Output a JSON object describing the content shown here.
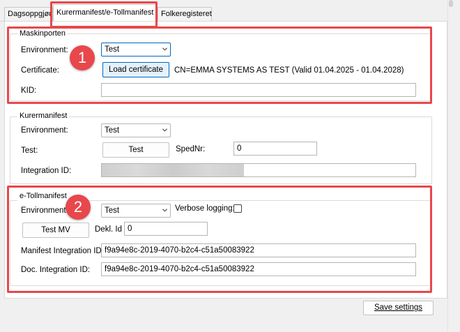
{
  "tabs": [
    {
      "label": "Dagsoppgjør"
    },
    {
      "label": "Kurermanifest/e-Tollmanifest"
    },
    {
      "label": "Folkeregisteret"
    }
  ],
  "maskinporten": {
    "title": "Maskinporten",
    "environment_label": "Environment:",
    "environment_value": "Test",
    "certificate_label": "Certificate:",
    "load_certificate_button": "Load certificate",
    "certificate_info": "CN=EMMA SYSTEMS AS TEST (Valid 01.04.2025 - 01.04.2028)",
    "kid_label": "KID:",
    "kid_value": ""
  },
  "kurermanifest": {
    "title": "Kurermanifest",
    "environment_label": "Environment:",
    "environment_value": "Test",
    "test_label": "Test:",
    "test_button": "Test",
    "spednr_label": "SpedNr:",
    "spednr_value": "0",
    "integration_id_label": "Integration ID:"
  },
  "etollmanifest": {
    "title": "e-Tollmanifest",
    "environment_label": "Environment:",
    "environment_value": "Test",
    "verbose_logging_label": "Verbose logging:",
    "verbose_logging_checked": false,
    "test_mv_button": "Test MV",
    "dekl_id_label": "Dekl. Id",
    "dekl_id_value": "0",
    "manifest_integration_id_label": "Manifest Integration ID:",
    "manifest_integration_id_value": "f9a94e8c-2019-4070-b2c4-c51a50083922",
    "doc_integration_id_label": "Doc. Integration ID:",
    "doc_integration_id_value": "f9a94e8c-2019-4070-b2c4-c51a50083922"
  },
  "footer": {
    "save_settings_button": "Save settings"
  },
  "annotations": {
    "badge_1": "1",
    "badge_2": "2"
  },
  "colors": {
    "annotation_red": "#e8474c",
    "focus_blue": "#0067c0",
    "button_default_bg": "#e5f1fb"
  }
}
